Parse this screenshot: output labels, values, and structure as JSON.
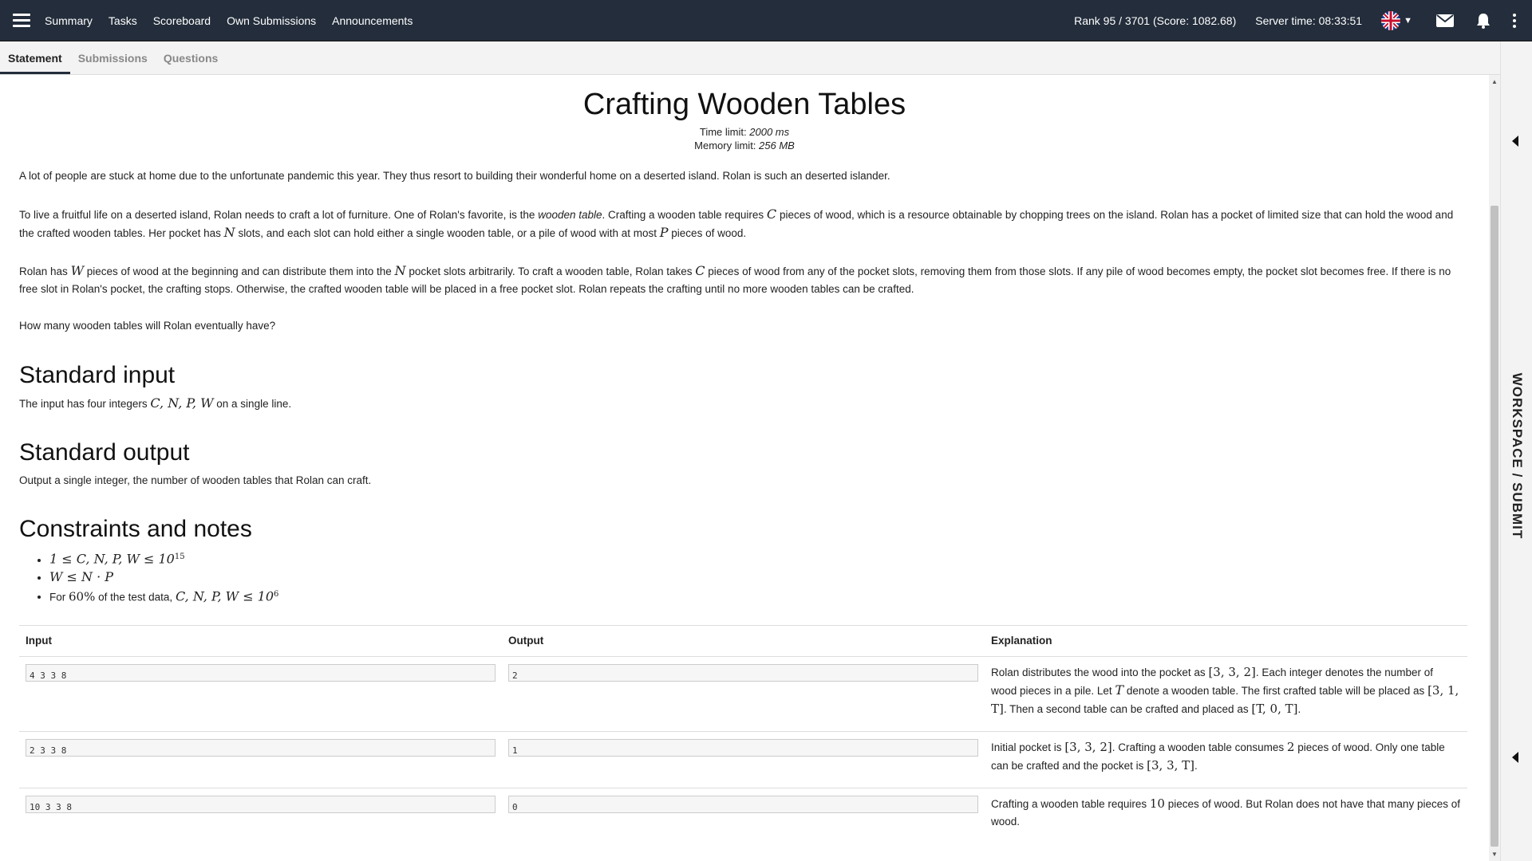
{
  "topbar": {
    "nav": [
      "Summary",
      "Tasks",
      "Scoreboard",
      "Own Submissions",
      "Announcements"
    ],
    "rank": "Rank 95 / 3701 (Score: 1082.68)",
    "server_time": "Server time: 08:33:51",
    "icons": [
      "menu-icon",
      "uk-flag-icon",
      "chevron-down-icon",
      "mail-icon",
      "bell-icon",
      "more-vertical-icon"
    ]
  },
  "tabs": [
    "Statement",
    "Submissions",
    "Questions"
  ],
  "active_tab": "Statement",
  "problem": {
    "title": "Crafting Wooden Tables",
    "time_limit_label": "Time limit:",
    "time_limit_value": "2000 ms",
    "memory_limit_label": "Memory limit:",
    "memory_limit_value": "256 MB",
    "p1": "A lot of people are stuck at home due to the unfortunate pandemic this year. They thus resort to building their wonderful home on a deserted island. Rolan is such an deserted islander.",
    "p2a": "To live a fruitful life on a deserted island, Rolan needs to craft a lot of furniture. One of Rolan's favorite, is the",
    "p2b": "wooden table",
    "p2c": ". Crafting a wooden table requires",
    "p2d": "pieces of wood, which is a resource obtainable by chopping trees on the island. Rolan has a pocket of limited size that can hold the wood and the crafted wooden tables. Her pocket has",
    "p2e": "slots, and each slot can hold either a single wooden table, or a pile of wood with at most",
    "p2f": "pieces of wood.",
    "p3a": "Rolan has",
    "p3b": "pieces of wood at the beginning and can distribute them into the",
    "p3c": "pocket slots arbitrarily. To craft a wooden table, Rolan takes",
    "p3d": "pieces of wood from any of the pocket slots, removing them from those slots. If any pile of wood becomes empty, the pocket slot becomes free. If there is no free slot in Rolan's pocket, the crafting stops. Otherwise, the crafted wooden table will be placed in a free pocket slot. Rolan repeats the crafting until no more wooden tables can be crafted.",
    "p4": "How many wooden tables will Rolan eventually have?",
    "input_heading": "Standard input",
    "input_text_a": "The input has four integers",
    "input_vars": "C, N, P, W",
    "input_text_b": "on a single line.",
    "output_heading": "Standard output",
    "output_text": "Output a single integer, the number of wooden tables that Rolan can craft.",
    "constraints_heading": "Constraints and notes",
    "constraints": {
      "c1_lhs": "1 ≤ C, N, P, W ≤ 10",
      "c1_exp": "15",
      "c2": "W ≤ N · P",
      "c3_a": "For",
      "c3_pct": "60%",
      "c3_b": "of the test data,",
      "c3_math": "C, N, P, W ≤ 10",
      "c3_exp": "6"
    },
    "vars": {
      "C": "C",
      "N": "N",
      "P": "P",
      "W": "W"
    }
  },
  "examples": {
    "headers": [
      "Input",
      "Output",
      "Explanation"
    ],
    "rows": [
      {
        "input": "4 3 3 8",
        "output": "2",
        "expl_a": "Rolan distributes the wood into the pocket as",
        "expl_m1": "[3, 3, 2]",
        "expl_b": ". Each integer denotes the number of wood pieces in a pile. Let",
        "expl_m2": "T",
        "expl_c": "denote a wooden table. The first crafted table will be placed as",
        "expl_m3": "[3, 1, T]",
        "expl_d": ". Then a second table can be crafted and placed as",
        "expl_m4": "[T, 0, T]",
        "expl_e": "."
      },
      {
        "input": "2 3 3 8",
        "output": "1",
        "expl_a": "Initial pocket is",
        "expl_m1": "[3, 3, 2]",
        "expl_b": ". Crafting a wooden table consumes",
        "expl_m2": "2",
        "expl_c": "pieces of wood. Only one table can be crafted and the pocket is",
        "expl_m3": "[3, 3, T]",
        "expl_d": "."
      },
      {
        "input": "10 3 3 8",
        "output": "0",
        "expl_a": "Crafting a wooden table requires",
        "expl_m1": "10",
        "expl_b": "pieces of wood. But Rolan does not have that many pieces of wood."
      }
    ]
  },
  "sidepanel": {
    "label": "WORKSPACE / SUBMIT"
  }
}
